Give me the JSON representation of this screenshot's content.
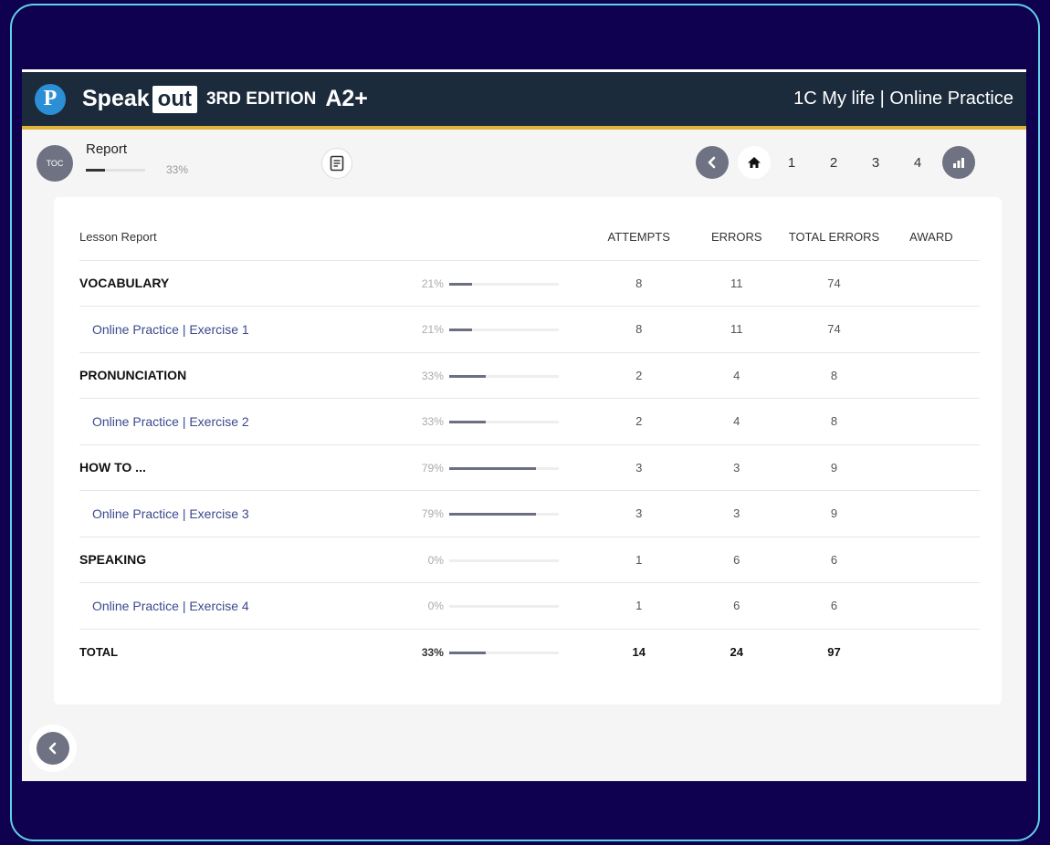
{
  "header": {
    "brand_speak": "Speak",
    "brand_out": "out",
    "brand_edition": "3RD EDITION",
    "brand_level": "A2+",
    "title": "1C My life | Online Practice"
  },
  "toolbar": {
    "toc_label": "TOC",
    "report_label": "Report",
    "report_progress": 33,
    "report_pct_text": "33%",
    "pages": [
      "1",
      "2",
      "3",
      "4"
    ]
  },
  "table": {
    "headers": {
      "lesson": "Lesson Report",
      "attempts": "ATTEMPTS",
      "errors": "ERRORS",
      "total_errors": "TOTAL ERRORS",
      "award": "AWARD"
    },
    "rows": [
      {
        "label": "VOCABULARY",
        "kind": "group",
        "pct": "21%",
        "progress": 21,
        "attempts": "8",
        "errors": "11",
        "total_errors": "74"
      },
      {
        "label": "Online Practice | Exercise 1",
        "kind": "sub",
        "pct": "21%",
        "progress": 21,
        "attempts": "8",
        "errors": "11",
        "total_errors": "74"
      },
      {
        "label": "PRONUNCIATION",
        "kind": "group",
        "pct": "33%",
        "progress": 33,
        "attempts": "2",
        "errors": "4",
        "total_errors": "8"
      },
      {
        "label": "Online Practice | Exercise 2",
        "kind": "sub",
        "pct": "33%",
        "progress": 33,
        "attempts": "2",
        "errors": "4",
        "total_errors": "8"
      },
      {
        "label": "HOW TO ...",
        "kind": "group",
        "pct": "79%",
        "progress": 79,
        "attempts": "3",
        "errors": "3",
        "total_errors": "9"
      },
      {
        "label": "Online Practice | Exercise 3",
        "kind": "sub",
        "pct": "79%",
        "progress": 79,
        "attempts": "3",
        "errors": "3",
        "total_errors": "9"
      },
      {
        "label": "SPEAKING",
        "kind": "group",
        "pct": "0%",
        "progress": 0,
        "attempts": "1",
        "errors": "6",
        "total_errors": "6"
      },
      {
        "label": "Online Practice | Exercise 4",
        "kind": "sub",
        "pct": "0%",
        "progress": 0,
        "attempts": "1",
        "errors": "6",
        "total_errors": "6"
      },
      {
        "label": "TOTAL",
        "kind": "total",
        "pct": "33%",
        "progress": 33,
        "attempts": "14",
        "errors": "24",
        "total_errors": "97"
      }
    ]
  },
  "colors": {
    "background": "#0f0050",
    "header": "#1c2b3c",
    "accent": "#e0b23a",
    "button": "#6e7282"
  }
}
